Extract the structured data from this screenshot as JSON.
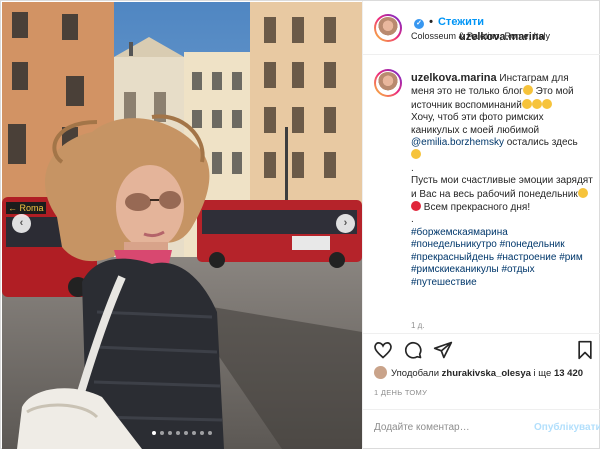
{
  "post": {
    "photo": {
      "alt_icon": "photo",
      "sign_roma": "← Roma",
      "carousel_dots": 8,
      "carousel_active_index": 0
    },
    "header": {
      "username": "uzelkova.marina",
      "verified_icon": "verified-badge-icon",
      "separator": "•",
      "follow_label": "Стежити",
      "location": "Colosseum & Paletino, Rome, Italy"
    },
    "caption": {
      "username": "uzelkova.marina",
      "text_1": "Инстаграм для меня это не только блог",
      "text_2": " Это мой источник воспоминаний",
      "text_3": "Хочу, чтоб эти фото римских каникулых с моей любимой ",
      "mention": "@emilia.borzhemsky",
      "text_4": " остались здесь",
      "dot_line": ".",
      "text_5": "Пусть мои счастливые эмоции зарядят и Вас на весь рабочий понедельник",
      "text_6": " Всем прекрасного дня!",
      "dot_line_2": ".",
      "hashtags": [
        "#боржемскаямарина",
        "#понедельникутро",
        "#понедельник",
        "#прекрасныйдень",
        "#настроение",
        "#рим",
        "#римскиеканикулы",
        "#отдых",
        "#путешествие"
      ],
      "time": "1 д."
    },
    "likes": {
      "prefix": "Уподобали ",
      "user": "zhurakivska_olesya",
      "middle": " і ще ",
      "count": "13 420"
    },
    "posted_ago": "1 ДЕНЬ ТОМУ",
    "comment": {
      "placeholder": "Додайте коментар…",
      "post_label": "Опублікувати"
    },
    "colors": {
      "accent": "#0095f6",
      "link": "#00376b",
      "muted": "#8e8e8e"
    }
  }
}
